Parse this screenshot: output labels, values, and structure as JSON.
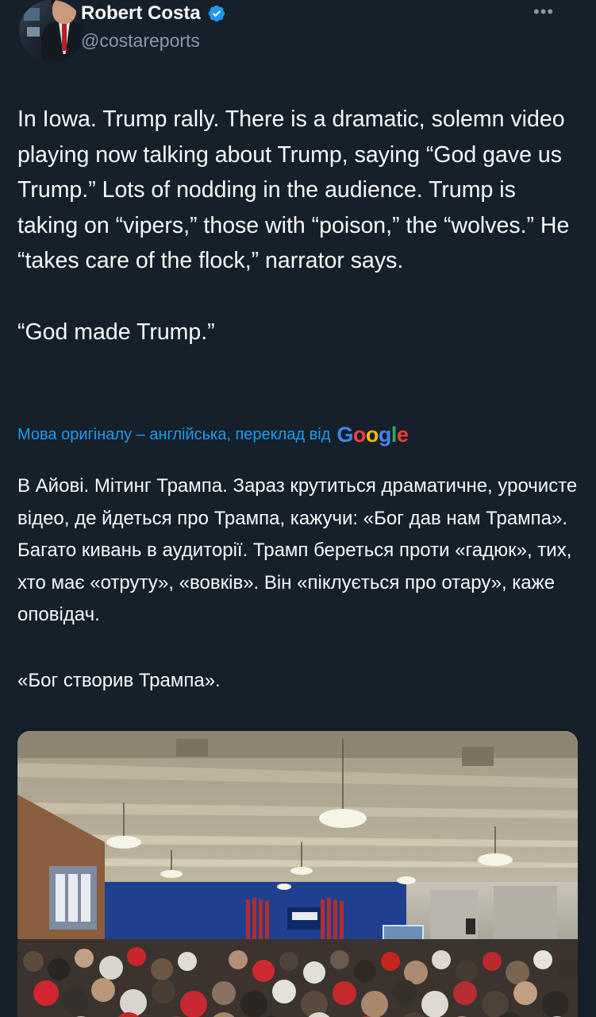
{
  "author": {
    "name": "Robert Costa",
    "handle": "@costareports",
    "verified": true,
    "verified_color": "#1d9bf0"
  },
  "more_menu": {
    "label": "•••"
  },
  "tweet": {
    "text": "In Iowa. Trump rally. There is a dramatic, solemn video playing now talking about Trump, saying “God gave us Trump.” Lots of nodding in the audience. Trump is taking on “vipers,” those with “poison,” the “wolves.” He “takes care of the flock,” narrator says.\n\n“God made Trump.”"
  },
  "translation": {
    "label": "Мова оригіналу – англійська, переклад від",
    "provider": "Google",
    "paragraph_1": "В Айові. Мітинг Трампа. Зараз крутиться драматичне, урочисте відео, де йдеться про Трампа, кажучи: «Бог дав нам Трампа». Багато кивань в аудиторії. Трамп береться проти «гадюк», тих, хто має «отруту», «вовків». Він «піклується про отару», каже оповідач.",
    "paragraph_2": "«Бог створив Трампа»."
  },
  "colors": {
    "background": "#15202b",
    "text": "#f7f9f9",
    "secondary": "#8b98a5",
    "link": "#1d9bf0"
  }
}
